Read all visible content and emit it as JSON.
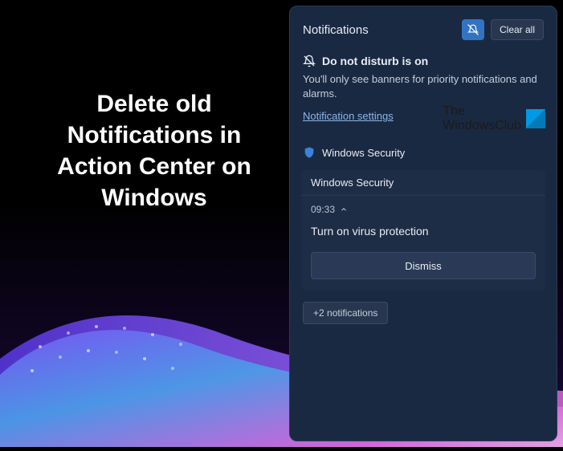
{
  "overlay": {
    "title": "Delete old Notifications in Action Center on Windows"
  },
  "watermark": {
    "line1": "The",
    "line2": "WindowsClub"
  },
  "panel": {
    "title": "Notifications",
    "clear_all": "Clear all",
    "dnd": {
      "title": "Do not disturb is on",
      "description": "You'll only see banners for priority notifications and alarms.",
      "settings_link": "Notification settings"
    },
    "app": {
      "name": "Windows Security"
    },
    "notification": {
      "header": "Windows Security",
      "time": "09:33",
      "title": "Turn on virus protection",
      "dismiss": "Dismiss"
    },
    "more": "+2 notifications"
  }
}
